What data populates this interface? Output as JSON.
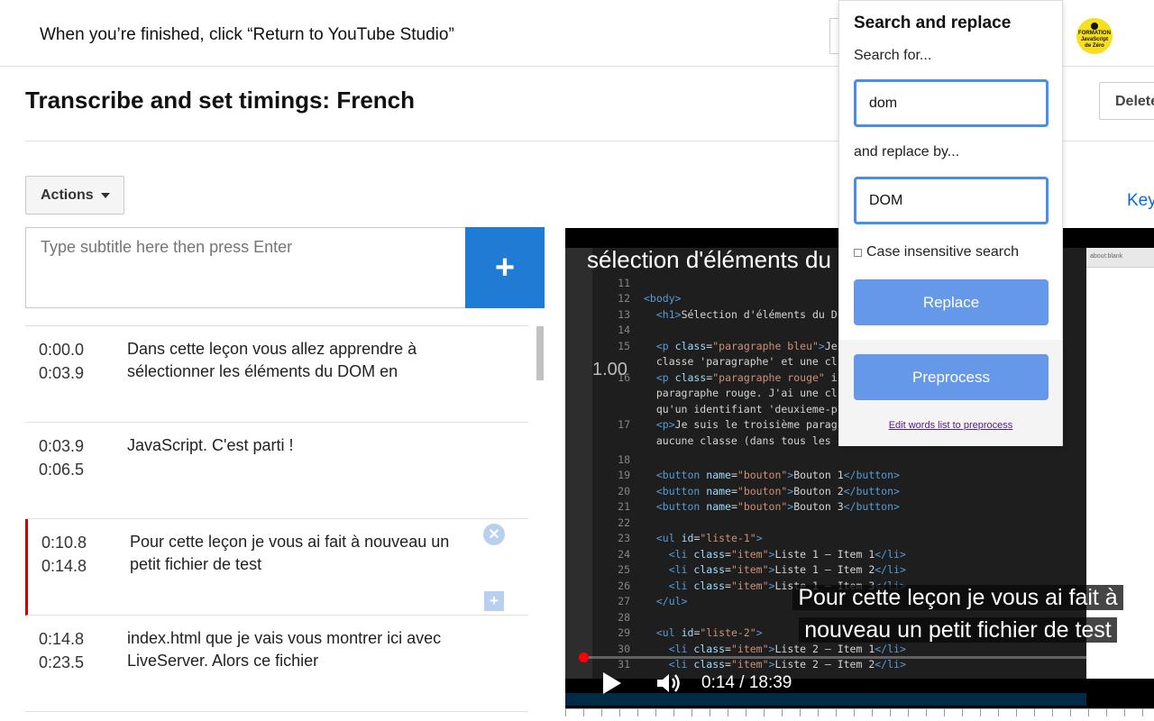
{
  "topbar": {
    "message": "When you’re finished, click “Return to YouTube Studio”",
    "logo_lines": [
      "FORMATION",
      "JavaScript",
      "de Zéro"
    ]
  },
  "header": {
    "title": "Transcribe and set timings: French",
    "delete_label": "Delete",
    "key_label": "Key"
  },
  "toolbar": {
    "actions_label": "Actions"
  },
  "input": {
    "placeholder": "Type subtitle here then press Enter",
    "add_symbol": "+"
  },
  "captions": [
    {
      "start": "0:00.0",
      "end": "0:03.9",
      "text": "Dans cette leçon vous allez apprendre à sélectionner les éléments du DOM en"
    },
    {
      "start": "0:03.9",
      "end": "0:06.5",
      "text": "JavaScript. C'est parti !"
    },
    {
      "start": "0:10.8",
      "end": "0:14.8",
      "text": "Pour cette leçon je vous ai fait à nouveau un petit fichier de test"
    },
    {
      "start": "0:14.8",
      "end": "0:23.5",
      "text": "index.html que je vais vous montrer ici avec LiveServer. Alors ce fichier"
    }
  ],
  "video": {
    "title": "sélection d'éléments du",
    "speed": "1.00",
    "caption_line1": "Pour cette leçon je vous ai fait à",
    "caption_line2": "nouveau un petit fichier de test",
    "time": "0:14 / 18:39",
    "progress_fraction": 0.013,
    "browser_tab": "about:blank"
  },
  "search_replace": {
    "title": "Search and replace",
    "search_label": "Search for...",
    "search_value": "dom",
    "replace_label": "and replace by...",
    "replace_value": "DOM",
    "case_label": "Case insensitive search",
    "replace_button": "Replace",
    "preprocess_button": "Preprocess",
    "edit_link": "Edit words list to preprocess"
  },
  "colors": {
    "accent": "#1f7bd4",
    "active_marker": "#cc0000",
    "sr_button": "#6598e8"
  }
}
